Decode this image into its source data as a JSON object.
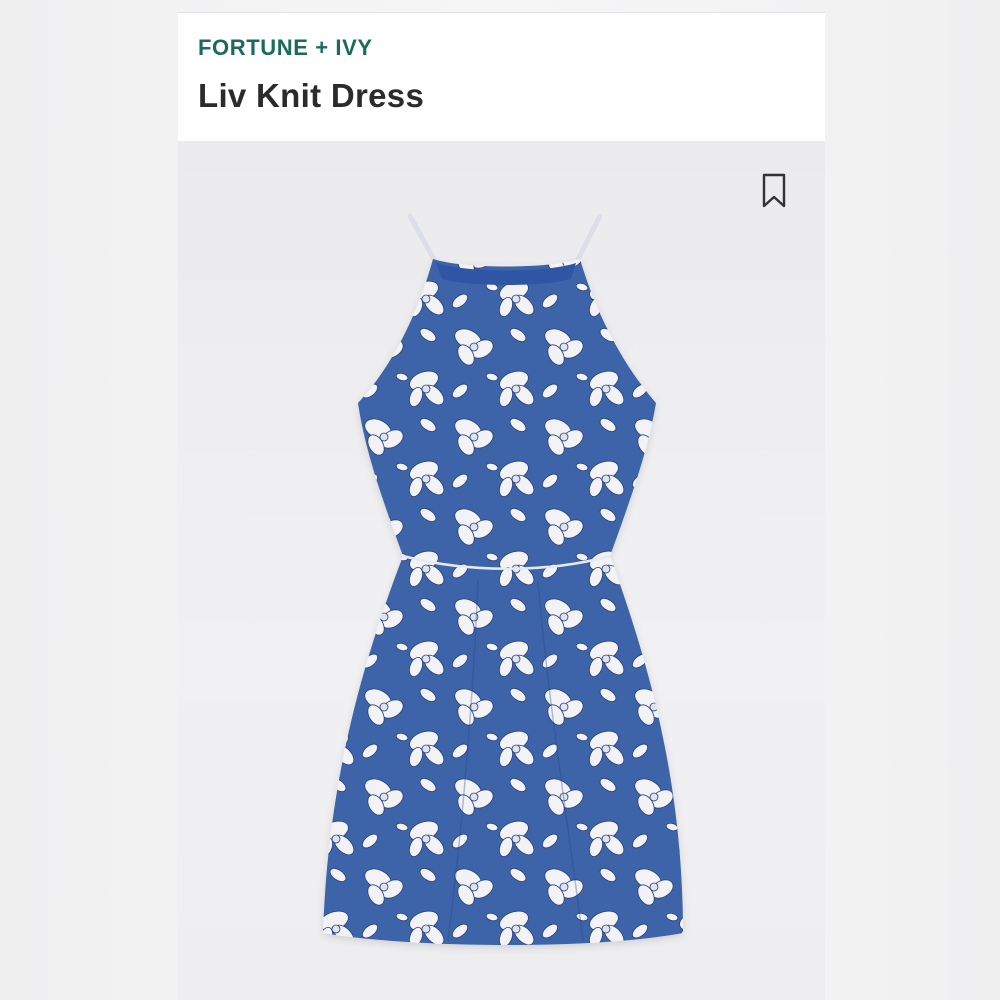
{
  "product": {
    "brand": "FORTUNE + IVY",
    "name": "Liv Knit Dress"
  },
  "icons": {
    "bookmark": "bookmark-icon"
  },
  "colors": {
    "brand": "#1a6b5a",
    "title": "#2b2b2b",
    "dress_blue": "#3a62a8",
    "flower_white": "#f4f4f6"
  }
}
